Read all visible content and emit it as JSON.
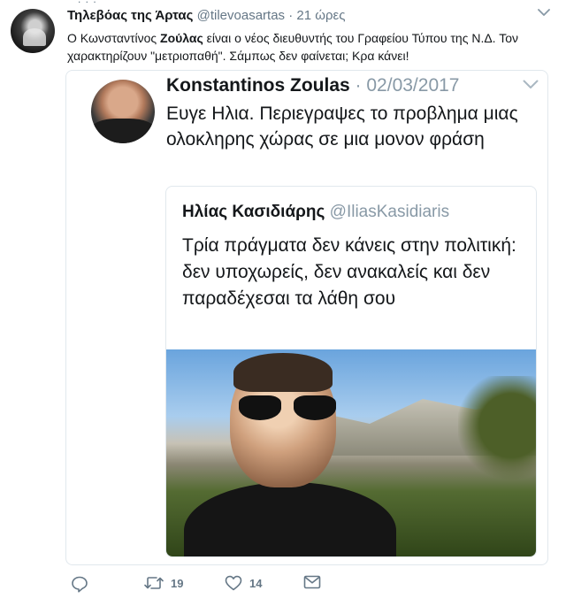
{
  "tweet": {
    "author_name": "Τηλεβόας της Άρτας",
    "author_handle": "@tilevoasartas",
    "separator": "·",
    "time": "21 ώρες",
    "text_before_bold": "Ο Κωνσταντίνος ",
    "text_bold": "Ζούλας",
    "text_after_bold": " είναι ο νέος διευθυντής του Γραφείου Τύπου της Ν.Δ. Τον χαρακτηρίζουν \"μετριοπαθή\". Σάμπως δεν φαίνεται; Κρα κάνει!"
  },
  "quoted": {
    "author_name": "Konstantinos Zoulas",
    "separator": "·",
    "date": "02/03/2017",
    "text": "Ευγε Ηλια. Περιεγραψες το προβλημα μιας ολοκληρης χώρας σε μια μονον φράση"
  },
  "inner_quote": {
    "author_name": "Ηλίας Κασιδιάρης",
    "author_handle": "@IliasKasidiaris",
    "text": "Τρία πράγματα δεν κάνεις στην πολιτική: δεν υποχωρείς, δεν ανακαλείς και δεν παραδέχεσαι τα λάθη σου"
  },
  "actions": {
    "reply_icon": "reply-icon",
    "retweet_icon": "retweet-icon",
    "retweet_count": "19",
    "like_icon": "heart-icon",
    "like_count": "14",
    "dm_icon": "envelope-icon"
  },
  "colors": {
    "text": "#14171a",
    "secondary": "#657786",
    "border": "#e1e8ed"
  }
}
